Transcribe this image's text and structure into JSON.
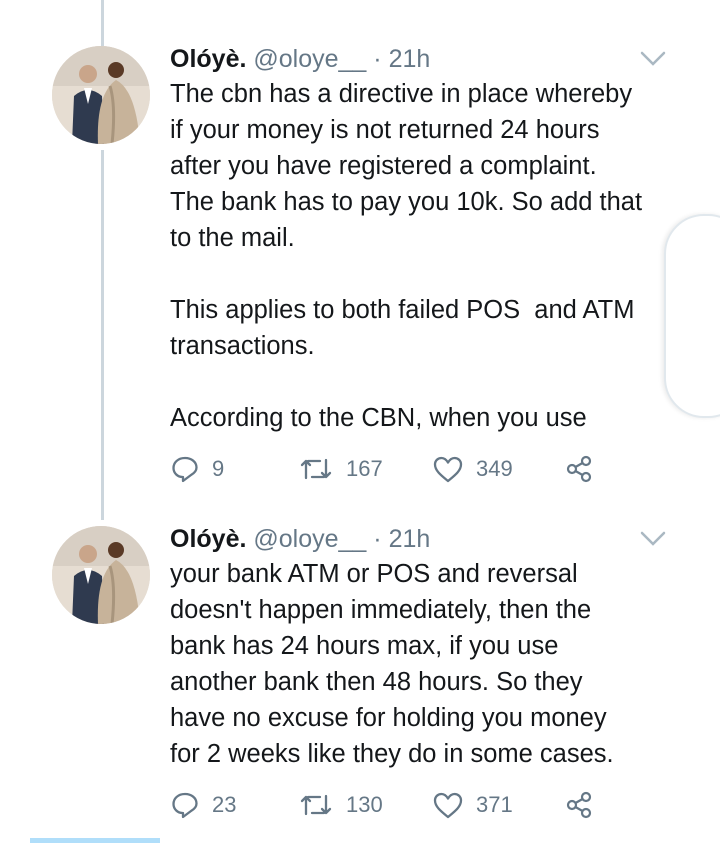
{
  "tweets": [
    {
      "name": "Olóyè.",
      "handle": "@oloye__",
      "dot": "·",
      "time": "21h",
      "text": "The cbn has a directive in place whereby\nif your money is not returned 24 hours\nafter you have registered a complaint.\nThe bank has to pay you 10k. So add that\nto the mail.\n\nThis applies to both failed POS  and ATM\ntransactions.\n\nAccording to the CBN, when you use",
      "replies": "9",
      "retweets": "167",
      "likes": "349"
    },
    {
      "name": "Olóyè.",
      "handle": "@oloye__",
      "dot": "·",
      "time": "21h",
      "text": "your bank ATM or POS and reversal\ndoesn't happen immediately, then the\nbank has 24 hours max, if you use\nanother bank then 48 hours. So they\nhave no excuse for holding you money\nfor 2 weeks like they do in some cases.",
      "replies": "23",
      "retweets": "130",
      "likes": "371"
    }
  ],
  "colors": {
    "text": "#14171a",
    "secondary": "#657786",
    "thread_line": "#ccd6dd"
  },
  "icons": [
    "reply-icon",
    "retweet-icon",
    "like-icon",
    "share-icon",
    "chevron-down-icon"
  ]
}
